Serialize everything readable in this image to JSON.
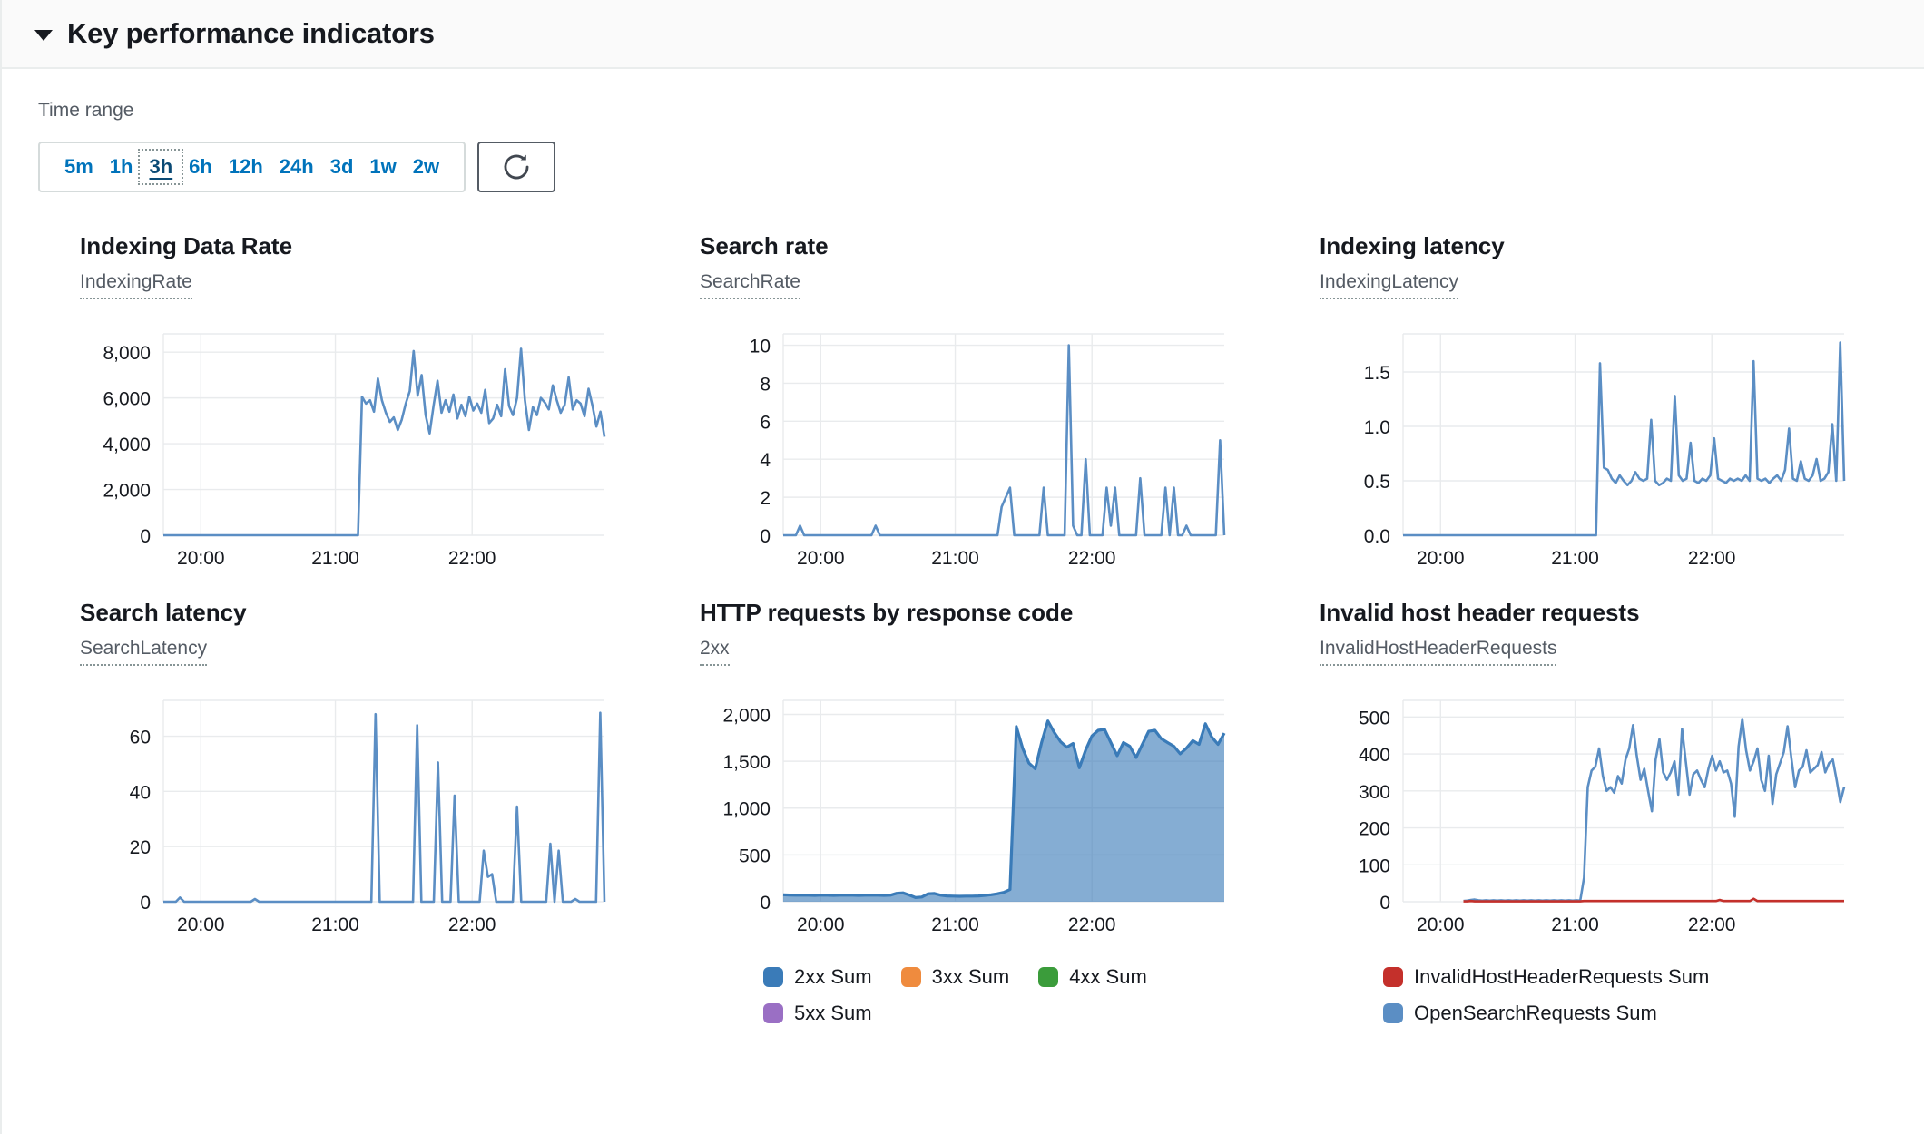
{
  "header": {
    "title": "Key performance indicators",
    "caret_icon": "caret-down-icon",
    "expanded": true
  },
  "time_range": {
    "label": "Time range",
    "options": [
      "5m",
      "1h",
      "3h",
      "6h",
      "12h",
      "24h",
      "3d",
      "1w",
      "2w"
    ],
    "selected": "3h",
    "refresh_icon": "refresh-icon"
  },
  "colors": {
    "series_blue": "#4a7fb5",
    "series_blue_line": "#5b8ec4",
    "legend_blue": "#3a7bb8",
    "legend_orange": "#ef8b3e",
    "legend_green": "#3b9c3b",
    "legend_purple": "#9a6fc4",
    "legend_red": "#c4302b",
    "grid": "#e9ebed",
    "axis_text": "#16191f",
    "link": "#0073bb"
  },
  "charts": [
    {
      "title": "Indexing Data Rate",
      "metric": "IndexingRate",
      "legend": []
    },
    {
      "title": "Search rate",
      "metric": "SearchRate",
      "legend": []
    },
    {
      "title": "Indexing latency",
      "metric": "IndexingLatency",
      "legend": []
    },
    {
      "title": "Search latency",
      "metric": "SearchLatency",
      "legend": []
    },
    {
      "title": "HTTP requests by response code",
      "metric": "2xx",
      "legend": [
        {
          "label": "2xx Sum",
          "color": "#3a7bb8"
        },
        {
          "label": "3xx Sum",
          "color": "#ef8b3e"
        },
        {
          "label": "4xx Sum",
          "color": "#3b9c3b"
        },
        {
          "label": "5xx Sum",
          "color": "#9a6fc4"
        }
      ]
    },
    {
      "title": "Invalid host header requests",
      "metric": "InvalidHostHeaderRequests",
      "legend": [
        {
          "label": "InvalidHostHeaderRequests Sum",
          "color": "#c4302b"
        },
        {
          "label": "OpenSearchRequests Sum",
          "color": "#5b8ec4"
        }
      ]
    }
  ],
  "chart_data": [
    {
      "type": "line",
      "title": "Indexing Data Rate",
      "metric": "IndexingRate",
      "xlabel": "",
      "ylabel": "",
      "xticks": [
        "20:00",
        "21:00",
        "22:00"
      ],
      "yticks": [
        0,
        2000,
        4000,
        6000,
        8000
      ],
      "ylim": [
        0,
        8800
      ],
      "grid": true,
      "series": [
        {
          "name": "IndexingRate",
          "color": "#5b8ec4",
          "values": [
            0,
            0,
            0,
            0,
            0,
            0,
            0,
            0,
            0,
            0,
            0,
            0,
            0,
            0,
            0,
            0,
            0,
            0,
            0,
            0,
            0,
            0,
            0,
            0,
            0,
            0,
            0,
            0,
            0,
            0,
            0,
            0,
            0,
            0,
            0,
            0,
            0,
            0,
            0,
            0,
            0,
            0,
            0,
            0,
            0,
            0,
            0,
            0,
            0,
            0,
            6050,
            5750,
            5900,
            5400,
            6850,
            5900,
            5350,
            4950,
            5150,
            4600,
            5050,
            5750,
            6300,
            8050,
            6100,
            7000,
            5250,
            4450,
            5650,
            6750,
            5350,
            5900,
            5400,
            6150,
            5100,
            5700,
            5200,
            6050,
            5450,
            5750,
            5350,
            6350,
            4900,
            5100,
            5700,
            5200,
            7250,
            5650,
            5250,
            6000,
            8150,
            5900,
            4600,
            5600,
            5250,
            6000,
            5800,
            5500,
            6550,
            5900,
            5350,
            5700,
            6900,
            5500,
            5900,
            5750,
            5200,
            6400,
            5650,
            4750,
            5400,
            4300
          ]
        }
      ]
    },
    {
      "type": "line",
      "title": "Search rate",
      "metric": "SearchRate",
      "xlabel": "",
      "ylabel": "",
      "xticks": [
        "20:00",
        "21:00",
        "22:00"
      ],
      "yticks": [
        0,
        2,
        4,
        6,
        8,
        10
      ],
      "ylim": [
        0,
        10.6
      ],
      "grid": true,
      "series": [
        {
          "name": "SearchRate",
          "color": "#5b8ec4",
          "values": [
            0,
            0,
            0,
            0,
            0.5,
            0,
            0,
            0,
            0,
            0,
            0,
            0,
            0,
            0,
            0,
            0,
            0,
            0,
            0,
            0,
            0,
            0,
            0.5,
            0,
            0,
            0,
            0,
            0,
            0,
            0,
            0,
            0,
            0,
            0,
            0,
            0,
            0,
            0,
            0,
            0,
            0,
            0,
            0,
            0,
            0,
            0,
            0,
            0,
            0,
            0,
            0,
            0,
            1.5,
            2,
            2.5,
            0,
            0,
            0,
            0,
            0,
            0,
            0,
            2.5,
            0,
            0,
            0,
            0,
            0,
            10,
            0.5,
            0,
            0,
            4,
            0,
            0,
            0,
            0,
            2.5,
            0.5,
            2.5,
            0,
            0,
            0,
            0,
            0,
            3,
            0,
            0,
            0,
            0,
            0,
            2.5,
            0,
            2.5,
            0,
            0,
            0.5,
            0,
            0,
            0,
            0,
            0,
            0,
            0,
            5,
            0
          ]
        }
      ]
    },
    {
      "type": "line",
      "title": "Indexing latency",
      "metric": "IndexingLatency",
      "xlabel": "",
      "ylabel": "",
      "xticks": [
        "20:00",
        "21:00",
        "22:00"
      ],
      "yticks": [
        0.0,
        0.5,
        1.0,
        1.5
      ],
      "ylim": [
        0,
        1.85
      ],
      "grid": true,
      "series": [
        {
          "name": "IndexingLatency",
          "color": "#5b8ec4",
          "values": [
            0,
            0,
            0,
            0,
            0,
            0,
            0,
            0,
            0,
            0,
            0,
            0,
            0,
            0,
            0,
            0,
            0,
            0,
            0,
            0,
            0,
            0,
            0,
            0,
            0,
            0,
            0,
            0,
            0,
            0,
            0,
            0,
            0,
            0,
            0,
            0,
            0,
            0,
            0,
            0,
            0,
            0,
            0,
            0,
            0,
            0,
            0,
            0,
            0,
            0,
            1.58,
            0.62,
            0.6,
            0.52,
            0.48,
            0.55,
            0.5,
            0.46,
            0.5,
            0.58,
            0.52,
            0.5,
            0.52,
            1.06,
            0.5,
            0.46,
            0.48,
            0.52,
            0.5,
            1.28,
            0.55,
            0.5,
            0.52,
            0.85,
            0.5,
            0.48,
            0.52,
            0.5,
            0.55,
            0.89,
            0.52,
            0.5,
            0.48,
            0.52,
            0.5,
            0.52,
            0.5,
            0.55,
            0.5,
            1.6,
            0.52,
            0.5,
            0.52,
            0.48,
            0.52,
            0.55,
            0.5,
            0.6,
            0.98,
            0.52,
            0.5,
            0.68,
            0.52,
            0.5,
            0.55,
            0.7,
            0.5,
            0.52,
            0.58,
            1.02,
            0.5,
            1.77,
            0.5
          ]
        }
      ]
    },
    {
      "type": "line",
      "title": "Search latency",
      "metric": "SearchLatency",
      "xlabel": "",
      "ylabel": "",
      "xticks": [
        "20:00",
        "21:00",
        "22:00"
      ],
      "yticks": [
        0,
        20,
        40,
        60
      ],
      "ylim": [
        0,
        73
      ],
      "grid": true,
      "series": [
        {
          "name": "SearchLatency",
          "color": "#5b8ec4",
          "values": [
            0,
            0,
            0,
            0,
            1.5,
            0,
            0,
            0,
            0,
            0,
            0,
            0,
            0,
            0,
            0,
            0,
            0,
            0,
            0,
            0,
            0,
            0,
            1,
            0,
            0,
            0,
            0,
            0,
            0,
            0,
            0,
            0,
            0,
            0,
            0,
            0,
            0,
            0,
            0,
            0,
            0,
            0,
            0,
            0,
            0,
            0,
            0,
            0,
            0,
            0,
            0,
            68,
            0,
            0,
            0,
            0,
            0,
            0,
            0,
            0,
            0,
            64,
            0,
            0,
            0,
            0,
            50.5,
            0,
            0,
            0,
            38.5,
            0,
            0,
            0,
            0,
            0,
            0,
            18.5,
            9,
            10,
            0,
            0,
            0,
            0,
            0,
            34.5,
            0,
            0,
            0,
            0,
            0,
            0,
            0,
            21,
            0,
            18.5,
            0,
            0,
            0,
            1,
            0,
            0,
            0,
            0,
            0,
            68.5,
            0
          ]
        }
      ]
    },
    {
      "type": "area",
      "title": "HTTP requests by response code",
      "metric": "2xx",
      "xlabel": "",
      "ylabel": "",
      "xticks": [
        "20:00",
        "21:00",
        "22:00"
      ],
      "yticks": [
        0,
        500,
        1000,
        1500,
        2000
      ],
      "ylim": [
        0,
        2150
      ],
      "grid": true,
      "legend_position": "bottom",
      "series": [
        {
          "name": "2xx Sum",
          "color": "#3a7bb8",
          "values": [
            75,
            72,
            70,
            72,
            70,
            68,
            72,
            70,
            68,
            70,
            72,
            70,
            68,
            70,
            72,
            70,
            68,
            70,
            90,
            95,
            72,
            45,
            50,
            85,
            88,
            70,
            62,
            60,
            58,
            60,
            60,
            62,
            68,
            75,
            85,
            100,
            130,
            1870,
            1640,
            1480,
            1420,
            1700,
            1930,
            1810,
            1710,
            1650,
            1690,
            1430,
            1620,
            1770,
            1830,
            1840,
            1700,
            1560,
            1700,
            1660,
            1540,
            1680,
            1820,
            1830,
            1740,
            1700,
            1660,
            1580,
            1640,
            1720,
            1680,
            1900,
            1760,
            1680,
            1800
          ]
        },
        {
          "name": "3xx Sum",
          "color": "#ef8b3e",
          "values": []
        },
        {
          "name": "4xx Sum",
          "color": "#3b9c3b",
          "values": []
        },
        {
          "name": "5xx Sum",
          "color": "#9a6fc4",
          "values": []
        }
      ]
    },
    {
      "type": "line",
      "title": "Invalid host header requests",
      "metric": "InvalidHostHeaderRequests",
      "xlabel": "",
      "ylabel": "",
      "xticks": [
        "20:00",
        "21:00",
        "22:00"
      ],
      "yticks": [
        0,
        100,
        200,
        300,
        400,
        500
      ],
      "ylim": [
        0,
        545
      ],
      "grid": true,
      "legend_position": "bottom",
      "series": [
        {
          "name": "OpenSearchRequests Sum",
          "color": "#5b8ec4",
          "values": [
            null,
            null,
            null,
            null,
            null,
            null,
            null,
            null,
            null,
            null,
            null,
            null,
            null,
            null,
            null,
            null,
            2,
            3,
            5,
            6,
            4,
            3,
            4,
            3,
            4,
            3,
            4,
            3,
            4,
            3,
            4,
            3,
            4,
            3,
            4,
            3,
            4,
            3,
            4,
            3,
            4,
            3,
            4,
            3,
            4,
            3,
            4,
            3,
            65,
            310,
            355,
            365,
            415,
            340,
            300,
            310,
            295,
            340,
            320,
            385,
            415,
            478,
            395,
            330,
            360,
            300,
            245,
            385,
            440,
            350,
            330,
            350,
            380,
            290,
            468,
            380,
            290,
            345,
            355,
            330,
            310,
            360,
            395,
            355,
            380,
            350,
            355,
            320,
            230,
            420,
            495,
            410,
            355,
            380,
            415,
            330,
            300,
            395,
            265,
            345,
            375,
            405,
            475,
            390,
            310,
            355,
            365,
            410,
            350,
            360,
            370,
            405,
            350,
            375,
            385,
            330,
            270,
            310
          ]
        },
        {
          "name": "InvalidHostHeaderRequests Sum",
          "color": "#c4302b",
          "values": [
            null,
            null,
            null,
            null,
            null,
            null,
            null,
            null,
            null,
            null,
            null,
            null,
            null,
            null,
            null,
            null,
            1,
            1,
            2,
            1,
            1,
            1,
            1,
            1,
            1,
            1,
            1,
            1,
            1,
            1,
            1,
            1,
            1,
            1,
            1,
            1,
            1,
            1,
            1,
            1,
            1,
            1,
            1,
            1,
            1,
            1,
            1,
            1,
            2,
            2,
            2,
            2,
            2,
            2,
            2,
            2,
            2,
            2,
            2,
            2,
            2,
            2,
            2,
            2,
            2,
            2,
            2,
            2,
            2,
            2,
            2,
            2,
            2,
            2,
            2,
            2,
            2,
            2,
            2,
            2,
            2,
            2,
            2,
            2,
            5,
            2,
            2,
            2,
            2,
            2,
            2,
            2,
            2,
            8,
            2,
            2,
            2,
            2,
            2,
            2,
            2,
            2,
            2,
            2,
            2,
            2,
            2,
            2,
            2,
            2,
            2,
            2,
            2,
            2,
            2,
            2,
            2,
            2
          ]
        }
      ]
    }
  ]
}
